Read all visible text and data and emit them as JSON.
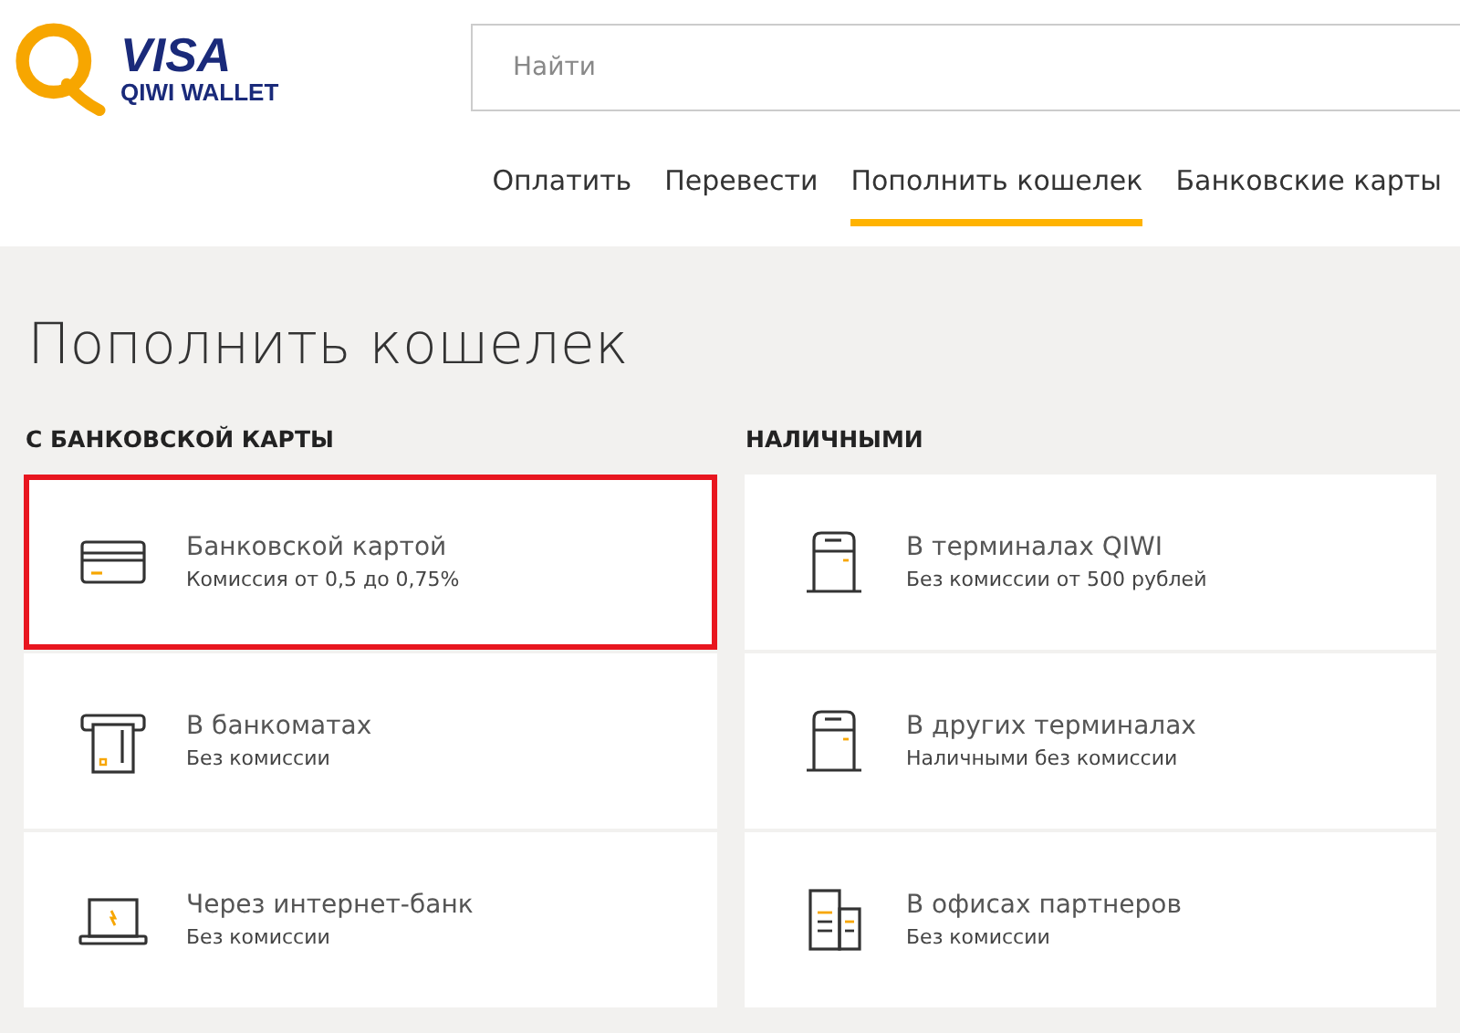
{
  "logo": {
    "brand": "VISA",
    "product": "QIWI WALLET"
  },
  "search": {
    "placeholder": "Найти"
  },
  "tabs": [
    {
      "label": "Оплатить",
      "selected": false
    },
    {
      "label": "Перевести",
      "selected": false
    },
    {
      "label": "Пополнить кошелек",
      "selected": true
    },
    {
      "label": "Банковские карты",
      "selected": false
    }
  ],
  "page_title": "Пополнить кошелек",
  "sections": [
    {
      "heading": "С БАНКОВСКОЙ КАРТЫ",
      "items": [
        {
          "kind": "card",
          "title": "Банковской картой",
          "subtitle": "Комиссия от 0,5 до 0,75%",
          "highlighted": true
        },
        {
          "kind": "atm",
          "title": "В банкоматах",
          "subtitle": "Без комиссии",
          "highlighted": false
        },
        {
          "kind": "laptop",
          "title": "Через интернет-банк",
          "subtitle": "Без комиссии",
          "highlighted": false
        }
      ]
    },
    {
      "heading": "НАЛИЧНЫМИ",
      "items": [
        {
          "kind": "terminal",
          "title": "В терминалах QIWI",
          "subtitle": "Без комиссии от 500 рублей",
          "highlighted": false
        },
        {
          "kind": "terminal",
          "title": "В других терминалах",
          "subtitle": "Наличными без комиссии",
          "highlighted": false
        },
        {
          "kind": "office",
          "title": "В офисах партнеров",
          "subtitle": "Без комиссии",
          "highlighted": false
        }
      ]
    }
  ]
}
